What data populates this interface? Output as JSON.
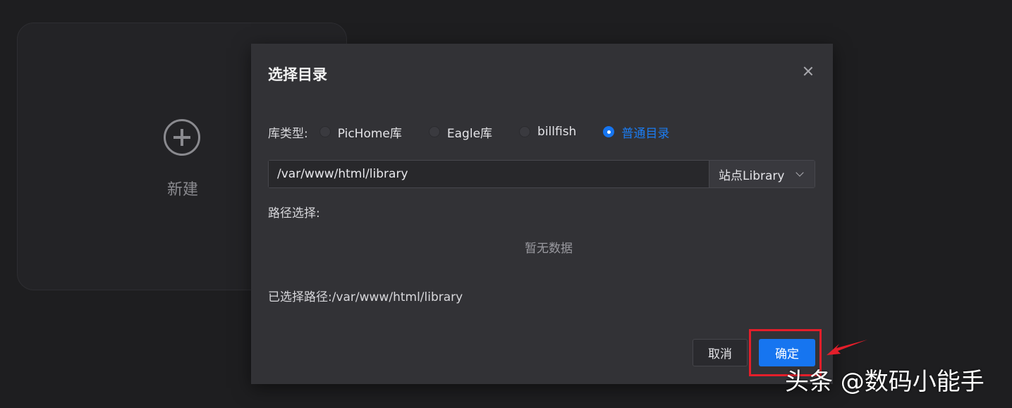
{
  "background_card": {
    "label": "新建",
    "icon": "plus-circle-icon"
  },
  "dialog": {
    "title": "选择目录",
    "close_icon": "close-icon",
    "library_type": {
      "label": "库类型:",
      "options": [
        {
          "label": "PicHome库",
          "checked": false
        },
        {
          "label": "Eagle库",
          "checked": false
        },
        {
          "label": "billfish",
          "checked": false
        },
        {
          "label": "普通目录",
          "checked": true
        }
      ]
    },
    "path_input": {
      "value": "/var/www/html/library"
    },
    "site_select": {
      "value": "站点Library"
    },
    "path_select_label": "路径选择:",
    "empty_text": "暂无数据",
    "selected_path": "已选择路径:/var/www/html/library",
    "buttons": {
      "cancel": "取消",
      "confirm": "确定"
    }
  },
  "annotation": {
    "highlight_color": "#e41e2a"
  },
  "watermark": "头条 @数码小能手",
  "colors": {
    "accent": "#1675f0",
    "dialog_bg": "#323236",
    "page_bg": "#1e1e20"
  }
}
